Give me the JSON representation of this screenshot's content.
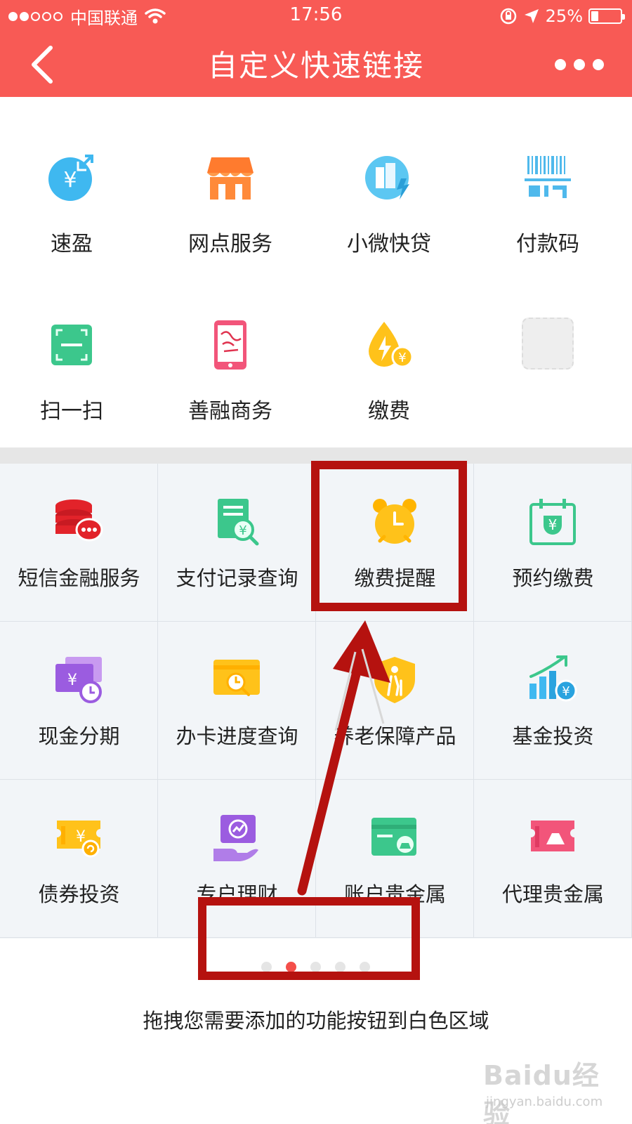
{
  "status_bar": {
    "carrier": "中国联通",
    "time": "17:56",
    "battery": "25%"
  },
  "header": {
    "title": "自定义快速链接"
  },
  "selected": [
    {
      "label": "速盈",
      "icon": "suying-icon"
    },
    {
      "label": "网点服务",
      "icon": "branch-shop-icon"
    },
    {
      "label": "小微快贷",
      "icon": "micro-loan-icon"
    },
    {
      "label": "付款码",
      "icon": "payment-code-icon"
    },
    {
      "label": "扫一扫",
      "icon": "scan-icon"
    },
    {
      "label": "善融商务",
      "icon": "shanrong-tablet-icon"
    },
    {
      "label": "缴费",
      "icon": "utility-drop-icon"
    }
  ],
  "grid": [
    {
      "label": "短信金融服务",
      "icon": "sms-finance-icon"
    },
    {
      "label": "支付记录查询",
      "icon": "payment-record-icon"
    },
    {
      "label": "缴费提醒",
      "icon": "alarm-clock-icon"
    },
    {
      "label": "预约缴费",
      "icon": "calendar-pay-icon"
    },
    {
      "label": "现金分期",
      "icon": "cash-installment-icon"
    },
    {
      "label": "办卡进度查询",
      "icon": "card-progress-icon"
    },
    {
      "label": "养老保障产品",
      "icon": "pension-shield-icon"
    },
    {
      "label": "基金投资",
      "icon": "fund-chart-icon"
    },
    {
      "label": "债券投资",
      "icon": "bond-ticket-icon"
    },
    {
      "label": "专户理财",
      "icon": "wealth-hand-icon"
    },
    {
      "label": "账户贵金属",
      "icon": "account-gold-icon"
    },
    {
      "label": "代理贵金属",
      "icon": "agent-gold-icon"
    }
  ],
  "pager": {
    "count": 5,
    "active_index": 1
  },
  "hint": "拖拽您需要添加的功能按钮到白色区域",
  "watermark": {
    "brand": "Baidu经验",
    "url": "jingyan.baidu.com"
  },
  "colors": {
    "header_bg": "#f85a55",
    "annotation": "#b5120f",
    "pager_active": "#f44f4a",
    "grid_bg": "#f2f5f8"
  }
}
